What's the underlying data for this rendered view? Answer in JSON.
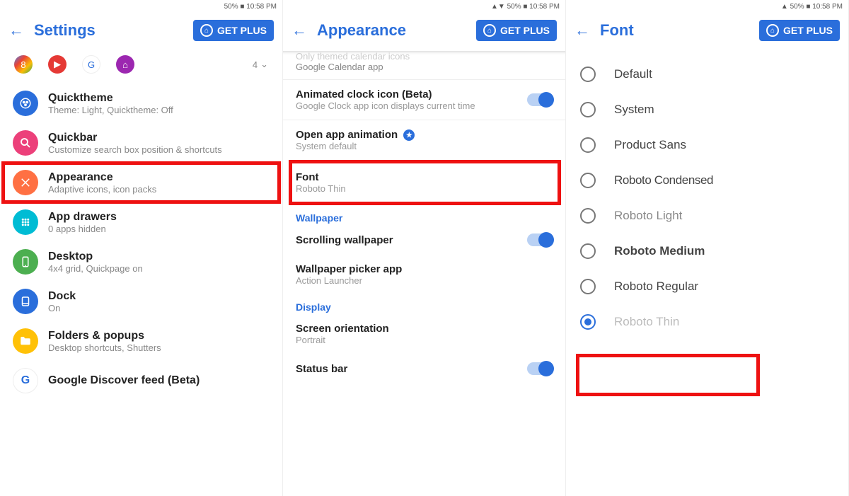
{
  "status": {
    "right1": "50% ■ 10:58 PM",
    "right2": "▲▼ 50% ■ 10:58 PM",
    "right3": "▲ 50% ■ 10:58 PM"
  },
  "header": {
    "settings": "Settings",
    "appearance": "Appearance",
    "font": "Font",
    "get_plus": "GET PLUS"
  },
  "pane1": {
    "icon_count": "4",
    "items": [
      {
        "name": "Quicktheme",
        "sub": "Theme: Light, Quicktheme: Off"
      },
      {
        "name": "Quickbar",
        "sub": "Customize search box position & shortcuts"
      },
      {
        "name": "Appearance",
        "sub": "Adaptive icons, icon packs"
      },
      {
        "name": "App drawers",
        "sub": "0 apps hidden"
      },
      {
        "name": "Desktop",
        "sub": "4x4 grid, Quickpage on"
      },
      {
        "name": "Dock",
        "sub": "On"
      },
      {
        "name": "Folders & popups",
        "sub": "Desktop shortcuts, Shutters"
      },
      {
        "name": "Google Discover feed (Beta)",
        "sub": ""
      }
    ]
  },
  "pane2": {
    "cut_sub1": "Only themed calendar icons",
    "cut_sub2": "Google Calendar app",
    "anim_clock": "Animated clock icon (Beta)",
    "anim_clock_sub": "Google Clock app icon displays current time",
    "open_anim": "Open app animation",
    "open_anim_sub": "System default",
    "font": "Font",
    "font_sub": "Roboto Thin",
    "wallpaper_cat": "Wallpaper",
    "scrolling": "Scrolling wallpaper",
    "picker": "Wallpaper picker app",
    "picker_sub": "Action Launcher",
    "display_cat": "Display",
    "orientation": "Screen orientation",
    "orientation_sub": "Portrait",
    "statusbar": "Status bar"
  },
  "pane3": {
    "options": [
      {
        "label": "Default",
        "cls": ""
      },
      {
        "label": "System",
        "cls": ""
      },
      {
        "label": "Product Sans",
        "cls": ""
      },
      {
        "label": "Roboto Condensed",
        "cls": "condensed"
      },
      {
        "label": "Roboto Light",
        "cls": "light"
      },
      {
        "label": "Roboto Medium",
        "cls": "medium"
      },
      {
        "label": "Roboto Regular",
        "cls": ""
      },
      {
        "label": "Roboto Thin",
        "cls": "thin"
      }
    ],
    "selected_index": 7
  }
}
